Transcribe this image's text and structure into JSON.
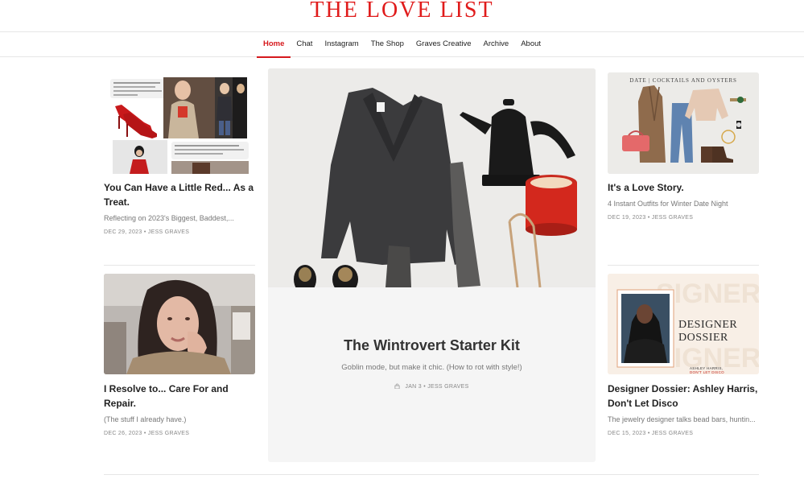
{
  "brand": "THE LOVE LIST",
  "nav": {
    "items": [
      "Home",
      "Chat",
      "Instagram",
      "The Shop",
      "Graves Creative",
      "Archive",
      "About"
    ],
    "active": "Home"
  },
  "posts": {
    "left_top": {
      "title": "You Can Have a Little Red... As a Treat.",
      "subtitle": "Reflecting on 2023's Biggest, Baddest,...",
      "meta": "DEC 29, 2023 • JESS GRAVES"
    },
    "left_bottom": {
      "title": "I Resolve to... Care For and Repair.",
      "subtitle": "(The stuff I already have.)",
      "meta": "DEC 26, 2023 • JESS GRAVES"
    },
    "feature": {
      "title": "The Wintrovert Starter Kit",
      "subtitle": "Goblin mode, but make it chic. (How to rot with style!)",
      "meta": "JAN 3 • JESS GRAVES"
    },
    "right_top": {
      "image_caption": "DATE | COCKTAILS AND OYSTERS",
      "title": "It's a Love Story.",
      "subtitle": "4 Instant Outfits for Winter Date Night",
      "meta": "DEC 19, 2023 • JESS GRAVES"
    },
    "right_bottom": {
      "image_text": "DESIGNER DOSSIER",
      "image_name": "ASHLEY HARRIS,",
      "image_tagline": "DON'T LET DISCO",
      "title": "Designer Dossier: Ashley Harris, Don't Let Disco",
      "subtitle": "The jewelry designer talks bead bars, huntin...",
      "meta": "DEC 15, 2023 • JESS GRAVES"
    }
  },
  "colors": {
    "brand": "#e01b1b",
    "accent": "#d6191d",
    "feature_bg": "#f5f5f5"
  }
}
